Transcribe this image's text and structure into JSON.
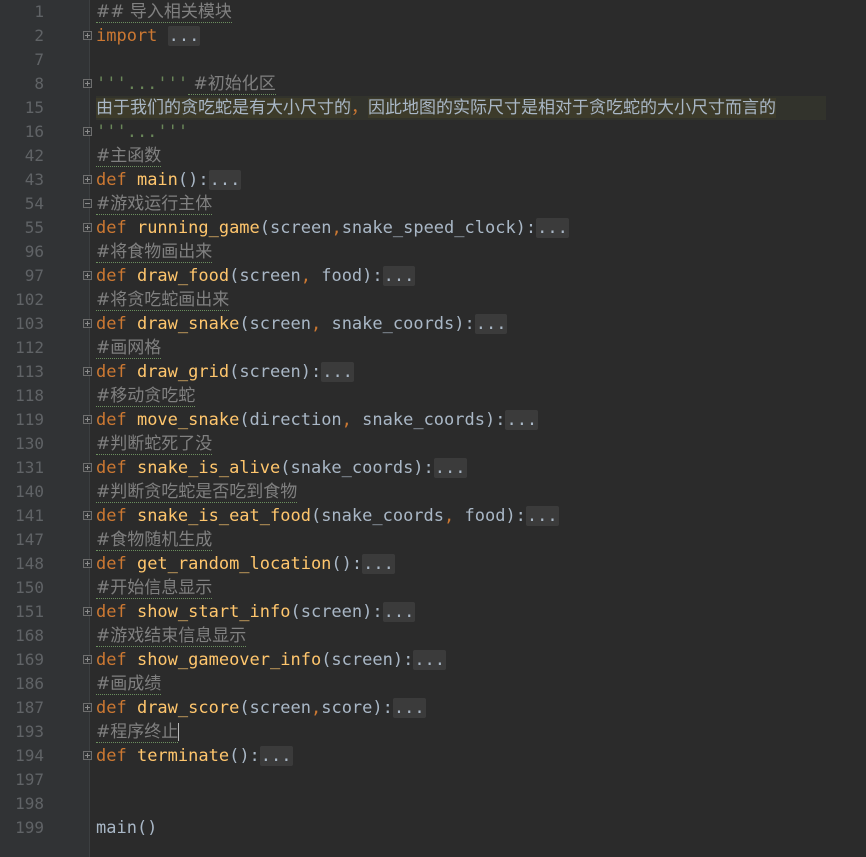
{
  "editor": {
    "colors": {
      "background": "#2b2b2b",
      "gutter": "#313335",
      "line_number": "#606366",
      "keyword": "#cc7832",
      "function": "#ffc66d",
      "comment": "#808080",
      "string": "#6a8759",
      "text": "#a9b7c6"
    },
    "lines": [
      {
        "num": "1",
        "fold": "",
        "tokens": [
          {
            "t": "## 导入相关模块",
            "c": "cm"
          }
        ]
      },
      {
        "num": "2",
        "fold": "plus",
        "tokens": [
          {
            "t": "import ",
            "c": "kw"
          },
          {
            "t": "...",
            "c": "fold"
          }
        ]
      },
      {
        "num": "7",
        "fold": "",
        "tokens": []
      },
      {
        "num": "8",
        "fold": "plus",
        "tokens": [
          {
            "t": "'''...'''",
            "c": "str"
          },
          {
            "t": " #初始化区",
            "c": "cm"
          }
        ]
      },
      {
        "num": "15",
        "fold": "",
        "hl": true,
        "tokens": [
          {
            "t": "由于我们的贪吃蛇是有大小尺寸的",
            "c": "doc"
          },
          {
            "t": "，",
            "c": "punc"
          },
          {
            "t": "因此地图的实际尺寸是相对于贪吃蛇的大小尺寸而言的",
            "c": "doc"
          }
        ]
      },
      {
        "num": "16",
        "fold": "plus",
        "tokens": [
          {
            "t": "'''...'''",
            "c": "str"
          }
        ]
      },
      {
        "num": "42",
        "fold": "",
        "tokens": [
          {
            "t": "#主函数",
            "c": "cm"
          }
        ]
      },
      {
        "num": "43",
        "fold": "plus",
        "tokens": [
          {
            "t": "def ",
            "c": "kw"
          },
          {
            "t": "main",
            "c": "fn"
          },
          {
            "t": "():",
            "c": "plain"
          },
          {
            "t": "...",
            "c": "fold"
          }
        ]
      },
      {
        "num": "54",
        "fold": "minus",
        "tokens": [
          {
            "t": "#游戏运行主体",
            "c": "cm"
          }
        ]
      },
      {
        "num": "55",
        "fold": "plus",
        "tokens": [
          {
            "t": "def ",
            "c": "kw"
          },
          {
            "t": "running_game",
            "c": "fn"
          },
          {
            "t": "(screen",
            "c": "plain"
          },
          {
            "t": ",",
            "c": "punc"
          },
          {
            "t": "snake_speed_clock):",
            "c": "plain"
          },
          {
            "t": "...",
            "c": "fold"
          }
        ]
      },
      {
        "num": "96",
        "fold": "",
        "tokens": [
          {
            "t": "#将食物画出来",
            "c": "cm"
          }
        ]
      },
      {
        "num": "97",
        "fold": "plus",
        "tokens": [
          {
            "t": "def ",
            "c": "kw"
          },
          {
            "t": "draw_food",
            "c": "fn"
          },
          {
            "t": "(screen",
            "c": "plain"
          },
          {
            "t": ", ",
            "c": "punc"
          },
          {
            "t": "food):",
            "c": "plain"
          },
          {
            "t": "...",
            "c": "fold"
          }
        ]
      },
      {
        "num": "102",
        "fold": "",
        "tokens": [
          {
            "t": "#将贪吃蛇画出来",
            "c": "cm"
          }
        ]
      },
      {
        "num": "103",
        "fold": "plus",
        "tokens": [
          {
            "t": "def ",
            "c": "kw"
          },
          {
            "t": "draw_snake",
            "c": "fn"
          },
          {
            "t": "(screen",
            "c": "plain"
          },
          {
            "t": ", ",
            "c": "punc"
          },
          {
            "t": "snake_coords):",
            "c": "plain"
          },
          {
            "t": "...",
            "c": "fold"
          }
        ]
      },
      {
        "num": "112",
        "fold": "",
        "tokens": [
          {
            "t": "#画网格",
            "c": "cm"
          }
        ]
      },
      {
        "num": "113",
        "fold": "plus",
        "tokens": [
          {
            "t": "def ",
            "c": "kw"
          },
          {
            "t": "draw_grid",
            "c": "fn"
          },
          {
            "t": "(screen):",
            "c": "plain"
          },
          {
            "t": "...",
            "c": "fold"
          }
        ]
      },
      {
        "num": "118",
        "fold": "",
        "tokens": [
          {
            "t": "#移动贪吃蛇",
            "c": "cm"
          }
        ]
      },
      {
        "num": "119",
        "fold": "plus",
        "tokens": [
          {
            "t": "def ",
            "c": "kw"
          },
          {
            "t": "move_snake",
            "c": "fn"
          },
          {
            "t": "(direction",
            "c": "plain"
          },
          {
            "t": ", ",
            "c": "punc"
          },
          {
            "t": "snake_coords):",
            "c": "plain"
          },
          {
            "t": "...",
            "c": "fold"
          }
        ]
      },
      {
        "num": "130",
        "fold": "",
        "tokens": [
          {
            "t": "#判断蛇死了没",
            "c": "cm"
          }
        ]
      },
      {
        "num": "131",
        "fold": "plus",
        "tokens": [
          {
            "t": "def ",
            "c": "kw"
          },
          {
            "t": "snake_is_alive",
            "c": "fn"
          },
          {
            "t": "(snake_coords):",
            "c": "plain"
          },
          {
            "t": "...",
            "c": "fold"
          }
        ]
      },
      {
        "num": "140",
        "fold": "",
        "tokens": [
          {
            "t": "#判断贪吃蛇是否吃到食物",
            "c": "cm"
          }
        ]
      },
      {
        "num": "141",
        "fold": "plus",
        "tokens": [
          {
            "t": "def ",
            "c": "kw"
          },
          {
            "t": "snake_is_eat_food",
            "c": "fn"
          },
          {
            "t": "(snake_coords",
            "c": "plain"
          },
          {
            "t": ", ",
            "c": "punc"
          },
          {
            "t": "food):",
            "c": "plain"
          },
          {
            "t": "...",
            "c": "fold"
          }
        ]
      },
      {
        "num": "147",
        "fold": "",
        "tokens": [
          {
            "t": "#食物随机生成",
            "c": "cm"
          }
        ]
      },
      {
        "num": "148",
        "fold": "plus",
        "tokens": [
          {
            "t": "def ",
            "c": "kw"
          },
          {
            "t": "get_random_location",
            "c": "fn"
          },
          {
            "t": "():",
            "c": "plain"
          },
          {
            "t": "...",
            "c": "fold"
          }
        ]
      },
      {
        "num": "150",
        "fold": "",
        "tokens": [
          {
            "t": "#开始信息显示",
            "c": "cm"
          }
        ]
      },
      {
        "num": "151",
        "fold": "plus",
        "tokens": [
          {
            "t": "def ",
            "c": "kw"
          },
          {
            "t": "show_start_info",
            "c": "fn"
          },
          {
            "t": "(screen):",
            "c": "plain"
          },
          {
            "t": "...",
            "c": "fold"
          }
        ]
      },
      {
        "num": "168",
        "fold": "",
        "tokens": [
          {
            "t": "#游戏结束信息显示",
            "c": "cm"
          }
        ]
      },
      {
        "num": "169",
        "fold": "plus",
        "tokens": [
          {
            "t": "def ",
            "c": "kw"
          },
          {
            "t": "show_gameover_info",
            "c": "fn"
          },
          {
            "t": "(screen):",
            "c": "plain"
          },
          {
            "t": "...",
            "c": "fold"
          }
        ]
      },
      {
        "num": "186",
        "fold": "",
        "tokens": [
          {
            "t": "#画成绩",
            "c": "cm"
          }
        ]
      },
      {
        "num": "187",
        "fold": "plus",
        "tokens": [
          {
            "t": "def ",
            "c": "kw"
          },
          {
            "t": "draw_score",
            "c": "fn"
          },
          {
            "t": "(screen",
            "c": "plain"
          },
          {
            "t": ",",
            "c": "punc"
          },
          {
            "t": "score):",
            "c": "plain"
          },
          {
            "t": "...",
            "c": "fold"
          }
        ]
      },
      {
        "num": "193",
        "fold": "",
        "cursor": true,
        "tokens": [
          {
            "t": "#程序终止",
            "c": "cm"
          }
        ]
      },
      {
        "num": "194",
        "fold": "plus",
        "tokens": [
          {
            "t": "def ",
            "c": "kw"
          },
          {
            "t": "terminate",
            "c": "fn"
          },
          {
            "t": "():",
            "c": "plain"
          },
          {
            "t": "...",
            "c": "fold"
          }
        ]
      },
      {
        "num": "197",
        "fold": "",
        "tokens": []
      },
      {
        "num": "198",
        "fold": "",
        "tokens": []
      },
      {
        "num": "199",
        "fold": "",
        "tokens": [
          {
            "t": "main()",
            "c": "plain"
          }
        ]
      }
    ]
  }
}
